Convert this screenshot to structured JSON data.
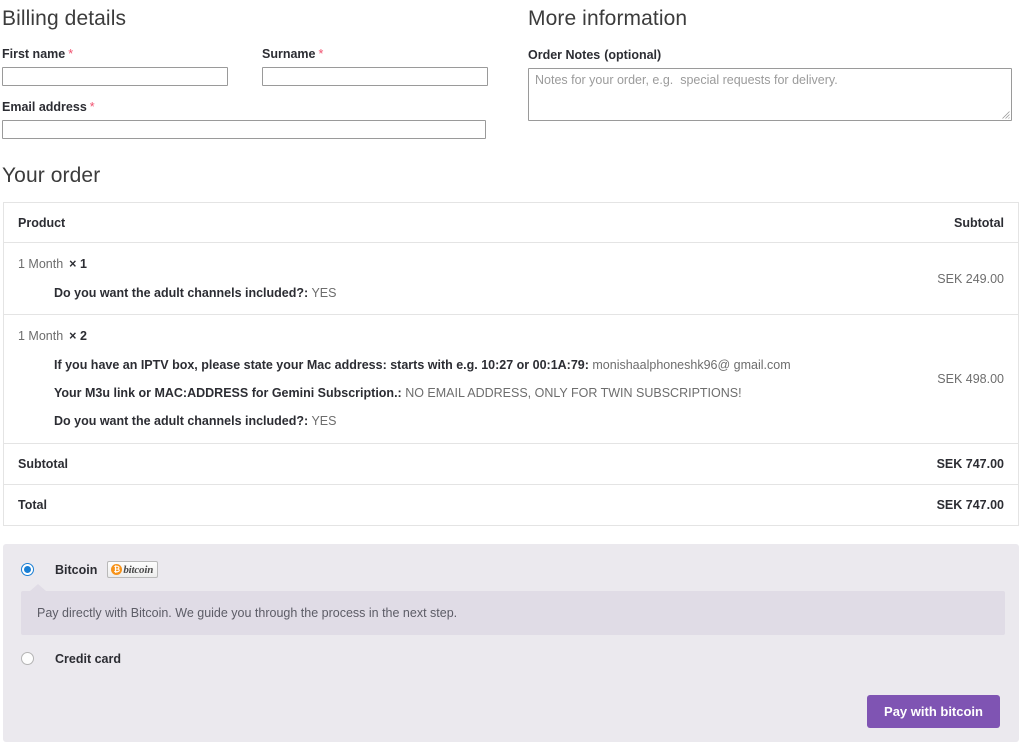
{
  "billing": {
    "title": "Billing details",
    "fields": [
      {
        "label": "First name",
        "required": "*",
        "value": "",
        "placeholder": ""
      },
      {
        "label": "Surname",
        "required": "*",
        "value": "",
        "placeholder": ""
      },
      {
        "label": "Email address",
        "required": "*",
        "value": "",
        "placeholder": ""
      }
    ]
  },
  "more_information": {
    "title": "More information",
    "notes_label": "Order Notes",
    "notes_optional": "(optional)",
    "notes_value": "",
    "notes_placeholder": "Notes for your order, e.g.  special requests for delivery."
  },
  "order": {
    "title": "Your order",
    "columns": {
      "product": "Product",
      "subtotal": "Subtotal"
    },
    "items": [
      {
        "name": "1 Month",
        "quantity": "× 1",
        "meta": [
          {
            "key": "Do you want the adult channels included?:",
            "value": "YES"
          }
        ],
        "subtotal": "SEK 249.00"
      },
      {
        "name": "1 Month",
        "quantity": "× 2",
        "meta": [
          {
            "key": "If you have an IPTV box, please state your Mac address: starts with e.g. 10:27 or 00:1A:79:",
            "value": "monishaalphoneshk96@ gmail.com"
          },
          {
            "key": "Your M3u link or MAC:ADDRESS for Gemini Subscription.:",
            "value": "NO EMAIL ADDRESS, ONLY FOR TWIN SUBSCRIPTIONS!"
          },
          {
            "key": "Do you want the adult channels included?:",
            "value": "YES"
          }
        ],
        "subtotal": "SEK 498.00"
      }
    ],
    "totals": [
      {
        "label": "Subtotal",
        "value": "SEK 747.00"
      },
      {
        "label": "Total",
        "value": "SEK 747.00"
      }
    ]
  },
  "payment": {
    "methods": [
      {
        "label": "Bitcoin",
        "selected": true,
        "badge_text": "bitcoin",
        "badge_symbol": "₿"
      },
      {
        "label": "Credit card",
        "selected": false
      }
    ],
    "description": "Pay directly with Bitcoin. We guide you through the process in the next step.",
    "submit_label": "Pay with bitcoin",
    "accent_color": "#7f54b3",
    "radio_color": "#1a7fd4",
    "bitcoin_orange": "#f7931a",
    "box_background": "#ebe9ee",
    "description_background": "#e0dce6"
  }
}
